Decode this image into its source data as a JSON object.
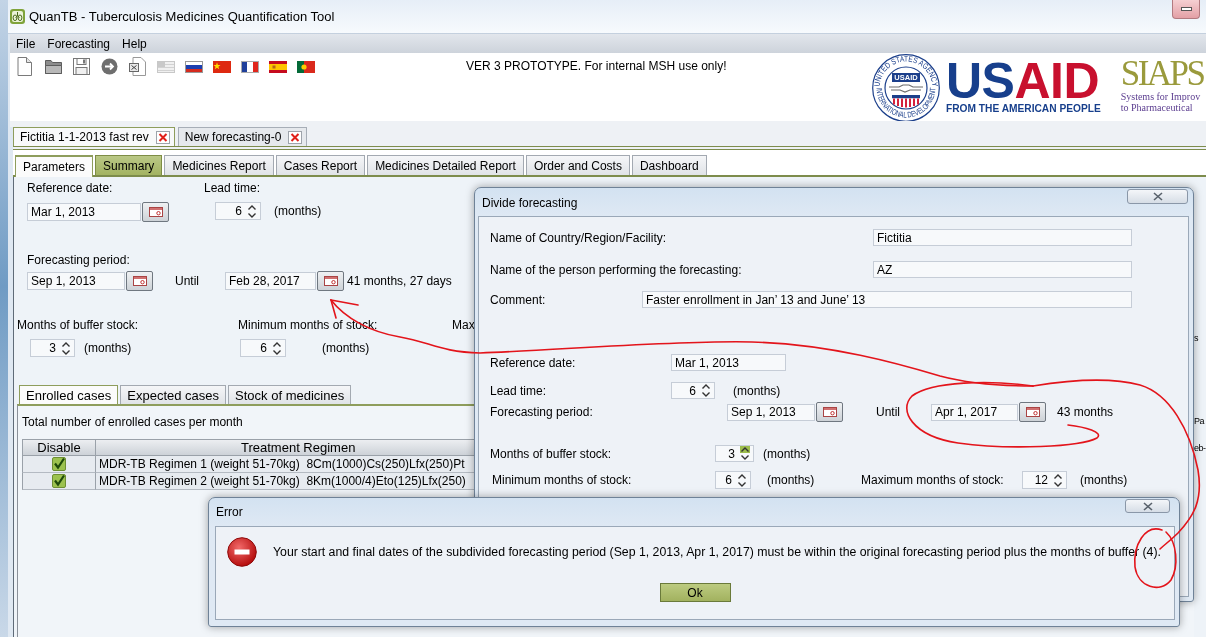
{
  "window": {
    "title": "QuanTB - Tuberculosis Medicines Quantification Tool"
  },
  "menu": [
    {
      "label": "File"
    },
    {
      "label": "Forecasting"
    },
    {
      "label": "Help"
    }
  ],
  "notice": "VER 3 PROTOTYPE. For internal MSH use only!",
  "logos": {
    "seal": {
      "ring_top": "UNITED STATES AGENCY",
      "ring_bottom": "INTERNATIONAL DEVELOPMENT",
      "badge": "USAID"
    },
    "wordmark": [
      "US",
      "AID"
    ],
    "tagline": "FROM THE AMERICAN PEOPLE",
    "siaps": {
      "name": "SIAPS",
      "lines": [
        "Systems for Improv",
        "to Pharmaceutical"
      ]
    }
  },
  "document_tabs": [
    {
      "label": "Fictitia 1-1-2013 fast rev",
      "selected": true
    },
    {
      "label": "New forecasting-0",
      "selected": false
    }
  ],
  "view_tabs": [
    {
      "label": "Parameters",
      "selected": true,
      "highlighted": false
    },
    {
      "label": "Summary",
      "selected": false,
      "highlighted": true
    },
    {
      "label": "Medicines Report",
      "selected": false,
      "highlighted": false
    },
    {
      "label": "Cases Report",
      "selected": false,
      "highlighted": false
    },
    {
      "label": "Medicines Detailed Report",
      "selected": false,
      "highlighted": false
    },
    {
      "label": "Order and Costs",
      "selected": false,
      "highlighted": false
    },
    {
      "label": "Dashboard",
      "selected": false,
      "highlighted": false
    }
  ],
  "parameters": {
    "reference_date": {
      "label": "Reference date:",
      "value": "Mar 1, 2013"
    },
    "lead_time": {
      "label": "Lead time:",
      "value": "6",
      "unit": "(months)"
    },
    "forecasting_period": {
      "label": "Forecasting period:",
      "start": "Sep 1, 2013",
      "until": "Until",
      "end": "Feb 28, 2017",
      "duration": "41 months, 27 days"
    },
    "buffer_stock": {
      "label": "Months of buffer stock:",
      "value": "3",
      "unit": "(months)"
    },
    "minimum_stock": {
      "label": "Minimum months of stock:",
      "value": "6",
      "unit": "(months)"
    },
    "maximum_stock": {
      "label": "Max"
    }
  },
  "case_tabs": [
    {
      "label": "Enrolled cases",
      "selected": true
    },
    {
      "label": "Expected cases",
      "selected": false
    },
    {
      "label": "Stock of medicines",
      "selected": false
    }
  ],
  "enrolled_cases": {
    "caption": "Total number of enrolled cases per month",
    "columns": [
      "Disable",
      "Treatment Regimen"
    ],
    "rows": [
      {
        "checked": true,
        "regimen": "MDR-TB Regimen 1 (weight 51-70kg)  8Cm(1000)Cs(250)Lfx(250)Pt"
      },
      {
        "checked": true,
        "regimen": "MDR-TB Regimen 2 (weight 51-70kg)  8Km(1000/4)Eto(125)Lfx(250)"
      }
    ]
  },
  "edge_fragments": [
    "s",
    "Pa",
    "eb-"
  ],
  "divide_dialog": {
    "title": "Divide forecasting",
    "country": {
      "label": "Name of Country/Region/Facility:",
      "value": "Fictitia"
    },
    "person": {
      "label": "Name of the person performing the forecasting:",
      "value": "AZ"
    },
    "comment": {
      "label": "Comment:",
      "value": "Faster enrollment in Jan’ 13 and June’ 13"
    },
    "reference_date": {
      "label": "Reference date:",
      "value": "Mar 1, 2013"
    },
    "lead_time": {
      "label": "Lead time:",
      "value": "6",
      "unit": "(months)"
    },
    "forecasting_period": {
      "label": "Forecasting period:",
      "start": "Sep 1, 2013",
      "until": "Until",
      "end": "Apr 1, 2017",
      "duration": "43 months"
    },
    "buffer_stock": {
      "label": "Months of buffer stock:",
      "value": "3",
      "unit": "(months)",
      "up_arrow_highlighted": true
    },
    "minimum_stock": {
      "label": "Minimum months of stock:",
      "value": "6",
      "unit": "(months)"
    },
    "maximum_stock": {
      "label": "Maximum months of stock:",
      "value": "12",
      "unit": "(months)"
    }
  },
  "error_dialog": {
    "title": "Error",
    "message": "Your start and final dates of the subdivided forecasting period (Sep 1, 2013, Apr 1, 2017) must be within the original forecasting period plus the months of buffer (4).",
    "button": "Ok"
  }
}
